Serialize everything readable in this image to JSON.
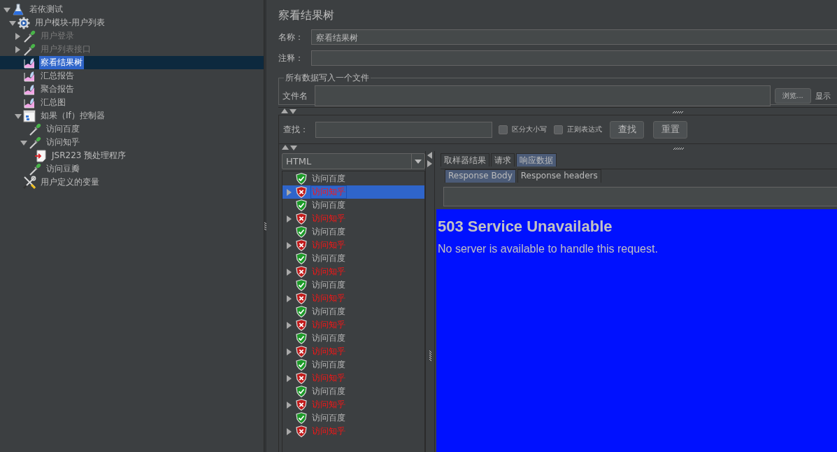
{
  "tree": [
    {
      "label": "若依测试",
      "kind": "flask",
      "expanded": true,
      "disabled": false,
      "selected": false,
      "children": [
        {
          "label": "用户模块-用户列表",
          "kind": "gear",
          "expanded": true,
          "disabled": false,
          "selected": false,
          "children": [
            {
              "label": "用户登录",
              "kind": "sampler",
              "expanded": false,
              "disabled": true,
              "selected": false
            },
            {
              "label": "用户列表接口",
              "kind": "sampler",
              "expanded": false,
              "disabled": true,
              "selected": false
            },
            {
              "label": "察看结果树",
              "kind": "listener",
              "disabled": false,
              "selected": true
            },
            {
              "label": "汇总报告",
              "kind": "listener",
              "disabled": false,
              "selected": false
            },
            {
              "label": "聚合报告",
              "kind": "listener",
              "disabled": false,
              "selected": false
            },
            {
              "label": "汇总图",
              "kind": "listener",
              "disabled": false,
              "selected": false
            },
            {
              "label": "如果（If）控制器",
              "kind": "controller",
              "expanded": true,
              "disabled": false,
              "selected": false,
              "children": [
                {
                  "label": "访问百度",
                  "kind": "sampler",
                  "disabled": false,
                  "selected": false
                },
                {
                  "label": "访问知乎",
                  "kind": "sampler",
                  "expanded": true,
                  "disabled": false,
                  "selected": false,
                  "children": [
                    {
                      "label": "JSR223 预处理程序",
                      "kind": "preprocessor",
                      "disabled": false,
                      "selected": false
                    }
                  ]
                },
                {
                  "label": "访问豆瓣",
                  "kind": "sampler",
                  "disabled": false,
                  "selected": false
                }
              ]
            },
            {
              "label": "用户定义的变量",
              "kind": "config",
              "disabled": false,
              "selected": false
            }
          ]
        }
      ]
    }
  ],
  "panel": {
    "title": "察看结果树",
    "name_label": "名称：",
    "name_value": "察看结果树",
    "comment_label": "注释：",
    "file_group": "所有数据写入一个文件",
    "file_label": "文件名",
    "browse_button": "浏览...",
    "cut_text": "显示"
  },
  "search": {
    "label": "查找：",
    "checkboxes": [
      {
        "label": "区分大小写",
        "checked": false
      },
      {
        "label": "正则表达式",
        "checked": false
      }
    ],
    "buttons": [
      "查找",
      "重置"
    ]
  },
  "renderer": "HTML",
  "results": [
    {
      "label": "访问百度",
      "kind": "ok",
      "selected": false
    },
    {
      "label": "访问知乎",
      "kind": "fail",
      "selected": true
    },
    {
      "label": "访问百度",
      "kind": "ok",
      "selected": false
    },
    {
      "label": "访问知乎",
      "kind": "fail",
      "selected": false
    },
    {
      "label": "访问百度",
      "kind": "ok",
      "selected": false
    },
    {
      "label": "访问知乎",
      "kind": "fail",
      "selected": false
    },
    {
      "label": "访问百度",
      "kind": "ok",
      "selected": false
    },
    {
      "label": "访问知乎",
      "kind": "fail",
      "selected": false
    },
    {
      "label": "访问百度",
      "kind": "ok",
      "selected": false
    },
    {
      "label": "访问知乎",
      "kind": "fail",
      "selected": false
    },
    {
      "label": "访问百度",
      "kind": "ok",
      "selected": false
    },
    {
      "label": "访问知乎",
      "kind": "fail",
      "selected": false
    },
    {
      "label": "访问百度",
      "kind": "ok",
      "selected": false
    },
    {
      "label": "访问知乎",
      "kind": "fail",
      "selected": false
    },
    {
      "label": "访问百度",
      "kind": "ok",
      "selected": false
    },
    {
      "label": "访问知乎",
      "kind": "fail",
      "selected": false
    },
    {
      "label": "访问百度",
      "kind": "ok",
      "selected": false
    },
    {
      "label": "访问知乎",
      "kind": "fail",
      "selected": false
    },
    {
      "label": "访问百度",
      "kind": "ok",
      "selected": false
    },
    {
      "label": "访问知乎",
      "kind": "fail",
      "selected": false
    }
  ],
  "tabs": [
    {
      "label": "取样器结果",
      "selected": false
    },
    {
      "label": "请求",
      "selected": false
    },
    {
      "label": "响应数据",
      "selected": true
    }
  ],
  "subtabs": [
    {
      "label": "Response Body",
      "selected": true
    },
    {
      "label": "Response headers",
      "selected": false
    }
  ],
  "response": {
    "heading": "503 Service Unavailable",
    "text": "No server is available to handle this request."
  }
}
